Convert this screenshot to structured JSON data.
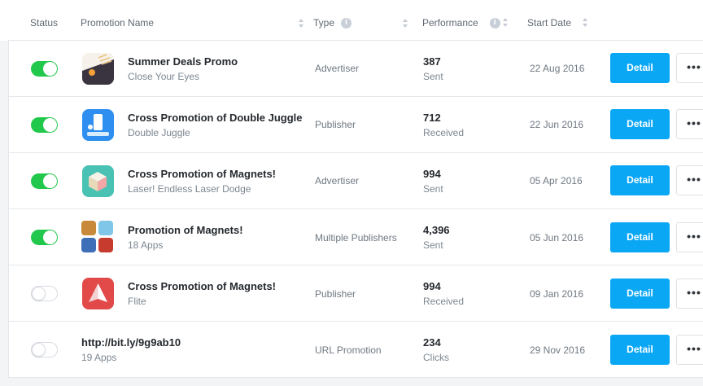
{
  "header": {
    "status": "Status",
    "name": "Promotion Name",
    "type": "Type",
    "performance": "Performance",
    "start_date": "Start Date"
  },
  "detail_label": "Detail",
  "more_label": "•••",
  "rows": [
    {
      "enabled": true,
      "name": "Summer Deals Promo",
      "app": "Close Your Eyes",
      "type": "Advertiser",
      "count": "387",
      "metric": "Sent",
      "date": "22 Aug 2016",
      "icon": "close-your-eyes-app-icon"
    },
    {
      "enabled": true,
      "name": "Cross Promotion of Double Juggle",
      "app": "Double Juggle",
      "type": "Publisher",
      "count": "712",
      "metric": "Received",
      "date": "22 Jun 2016",
      "icon": "double-juggle-app-icon"
    },
    {
      "enabled": true,
      "name": "Cross Promotion of Magnets!",
      "app": "Laser! Endless Laser Dodge",
      "type": "Advertiser",
      "count": "994",
      "metric": "Sent",
      "date": "05 Apr 2016",
      "icon": "laser-app-icon"
    },
    {
      "enabled": true,
      "name": "Promotion of Magnets!",
      "app": "18 Apps",
      "type": "Multiple Publishers",
      "count": "4,396",
      "metric": "Sent",
      "date": "05 Jun 2016",
      "icon": "multi-app-icon"
    },
    {
      "enabled": false,
      "name": "Cross Promotion of Magnets!",
      "app": "Flite",
      "type": "Publisher",
      "count": "994",
      "metric": "Received",
      "date": "09 Jan 2016",
      "icon": "flite-app-icon"
    },
    {
      "enabled": false,
      "name": "http://bit.ly/9g9ab10",
      "app": "19 Apps",
      "type": "URL Promotion",
      "count": "234",
      "metric": "Clicks",
      "date": "29 Nov 2016",
      "icon": ""
    }
  ],
  "colors": {
    "toggle_on": "#22c84b",
    "detail_button": "#0aa7f5"
  }
}
